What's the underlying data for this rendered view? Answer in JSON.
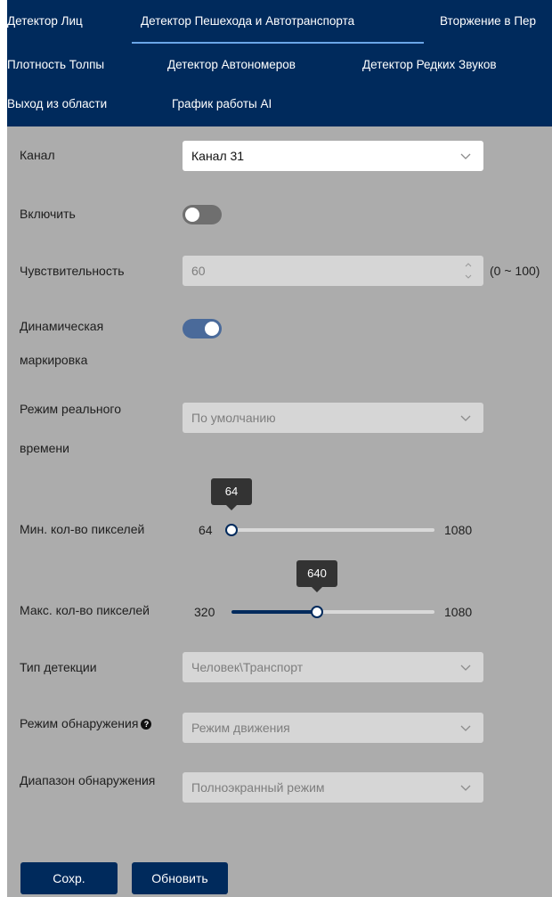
{
  "tabs": [
    {
      "label": "Детектор Лиц",
      "active": false
    },
    {
      "label": "Детектор Пешехода и Автотранспорта",
      "active": true
    },
    {
      "label": "Вторжение в Пер",
      "active": false
    },
    {
      "label": "Плотность Толпы",
      "active": false
    },
    {
      "label": "Детектор Автономеров",
      "active": false
    },
    {
      "label": "Детектор Редких Звуков",
      "active": false
    },
    {
      "label": "Выход из области",
      "active": false
    },
    {
      "label": "График работы AI",
      "active": false
    }
  ],
  "form": {
    "channel": {
      "label": "Канал",
      "value": "Канал 31"
    },
    "enable": {
      "label": "Включить",
      "on": false
    },
    "sensitivity": {
      "label": "Чувствительность",
      "value": "60",
      "range": "(0 ~ 100)"
    },
    "dynamic_marking": {
      "label_line1": "Динамическая",
      "label_line2": "маркировка",
      "on": true
    },
    "realtime_mode": {
      "label_line1": "Режим реального",
      "label_line2": "времени",
      "value": "По умолчанию"
    },
    "min_pixels": {
      "label": "Мин. кол-во пикселей",
      "min": "64",
      "max": "1080",
      "value": "64",
      "fraction": 0.0
    },
    "max_pixels": {
      "label": "Макс. кол-во пикселей",
      "min": "320",
      "max": "1080",
      "value": "640",
      "fraction": 0.421
    },
    "detection_type": {
      "label": "Тип детекции",
      "value": "Человек\\Транспорт"
    },
    "detection_mode": {
      "label": "Режим обнаружения",
      "help": "?",
      "value": "Режим движения"
    },
    "detection_range": {
      "label": "Диапазон обнаружения",
      "value": "Полноэкранный режим"
    }
  },
  "buttons": {
    "save": "Сохр.",
    "refresh": "Обновить"
  },
  "colors": {
    "header_bg": "#002a5c",
    "panel_bg": "#acacac",
    "toggle_on": "#4a6a9a",
    "toggle_off": "#6f6f6f"
  }
}
